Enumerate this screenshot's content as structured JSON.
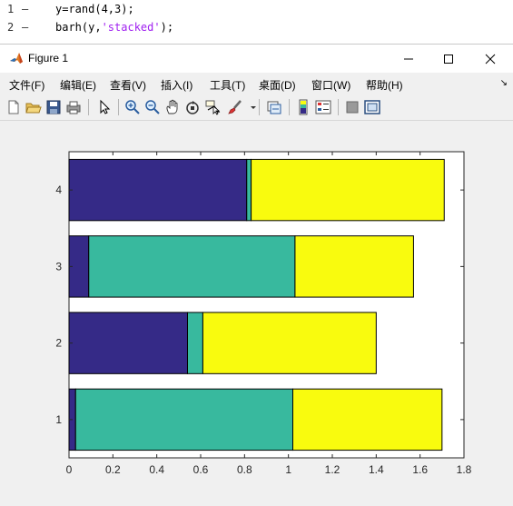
{
  "editor": {
    "lines": [
      {
        "num": "1",
        "dash": "—",
        "code": "y=rand(4,3);",
        "str": ""
      },
      {
        "num": "2",
        "dash": "—",
        "code": "barh(y,",
        "str": "'stacked'",
        "tail": ");"
      }
    ]
  },
  "window": {
    "title": "Figure 1",
    "icon": "matlab-logo-icon",
    "controls": [
      "minimize-icon",
      "maximize-icon",
      "close-icon"
    ]
  },
  "menu": {
    "items": [
      "文件(F)",
      "编辑(E)",
      "查看(V)",
      "插入(I)",
      "工具(T)",
      "桌面(D)",
      "窗口(W)",
      "帮助(H)"
    ],
    "overflow_icon": "dock-arrow-icon"
  },
  "toolbar": {
    "buttons": [
      "new-figure-icon",
      "open-file-icon",
      "save-icon",
      "print-icon",
      "edit-plot-icon",
      "zoom-in-icon",
      "zoom-out-icon",
      "pan-icon",
      "rotate-3d-icon",
      "data-cursor-icon",
      "brush-icon",
      "link-plot-icon",
      "insert-colorbar-icon",
      "insert-legend-icon",
      "hide-plot-tools-icon",
      "show-plot-tools-icon"
    ]
  },
  "colors": {
    "series1": "#352a87",
    "series2": "#38b99e",
    "series3": "#f9fb0e",
    "plot_bg": "#ffffff",
    "figure_bg": "#f0f0f0"
  },
  "chart_data": {
    "type": "bar",
    "orientation": "horizontal",
    "stacked": true,
    "categories": [
      "1",
      "2",
      "3",
      "4"
    ],
    "series": [
      {
        "values": [
          0.03,
          0.54,
          0.09,
          0.81
        ]
      },
      {
        "values": [
          0.99,
          0.07,
          0.94,
          0.02
        ]
      },
      {
        "values": [
          0.68,
          0.79,
          0.54,
          0.88
        ]
      }
    ],
    "xlim": [
      0,
      1.8
    ],
    "xticks": [
      "0",
      "0.2",
      "0.4",
      "0.6",
      "0.8",
      "1",
      "1.2",
      "1.4",
      "1.6",
      "1.8"
    ],
    "grid": false,
    "title": "",
    "xlabel": "",
    "ylabel": ""
  }
}
